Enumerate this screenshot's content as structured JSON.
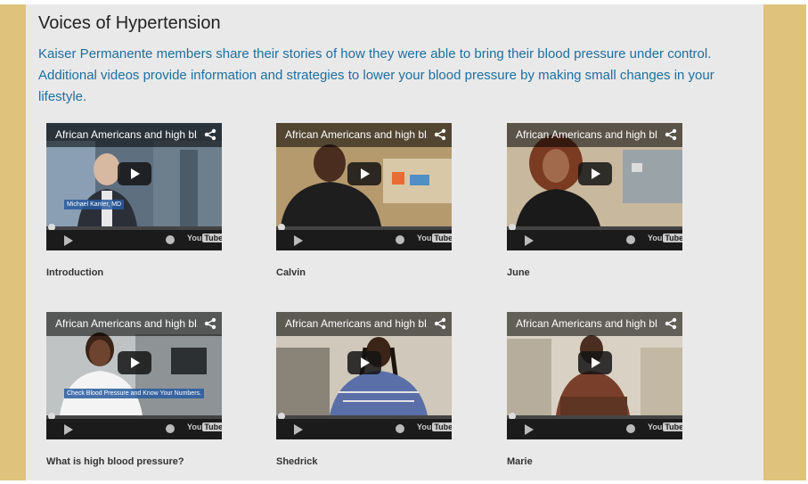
{
  "section": {
    "title": "Voices of Hypertension",
    "description": "Kaiser Permanente members share their stories of how they were able to bring their blood pressure under control. Additional videos provide information and strategies to lower your blood pressure by making small changes in your lifestyle."
  },
  "videos": [
    {
      "title": "African Americans and high bl...",
      "caption": "Introduction",
      "overlay": "Michael Kanter, MD",
      "watermark": "YouTube"
    },
    {
      "title": "African Americans and high bl...",
      "caption": "Calvin",
      "watermark": "YouTube"
    },
    {
      "title": "African Americans and high bl...",
      "caption": "June",
      "watermark": "YouTube"
    },
    {
      "title": "African Americans and high bl...",
      "caption": "What is high blood pressure?",
      "overlay": "Check Blood Pressure and Know Your Numbers.",
      "watermark": "YouTube"
    },
    {
      "title": "African Americans and high bl...",
      "caption": "Shedrick",
      "watermark": "YouTube"
    },
    {
      "title": "African Americans and high bl...",
      "caption": "Marie",
      "watermark": "YouTube"
    }
  ],
  "colors": {
    "side_bar": "#dfc27c",
    "panel": "#e9e9e9",
    "link_blue": "#1d6f9f"
  }
}
